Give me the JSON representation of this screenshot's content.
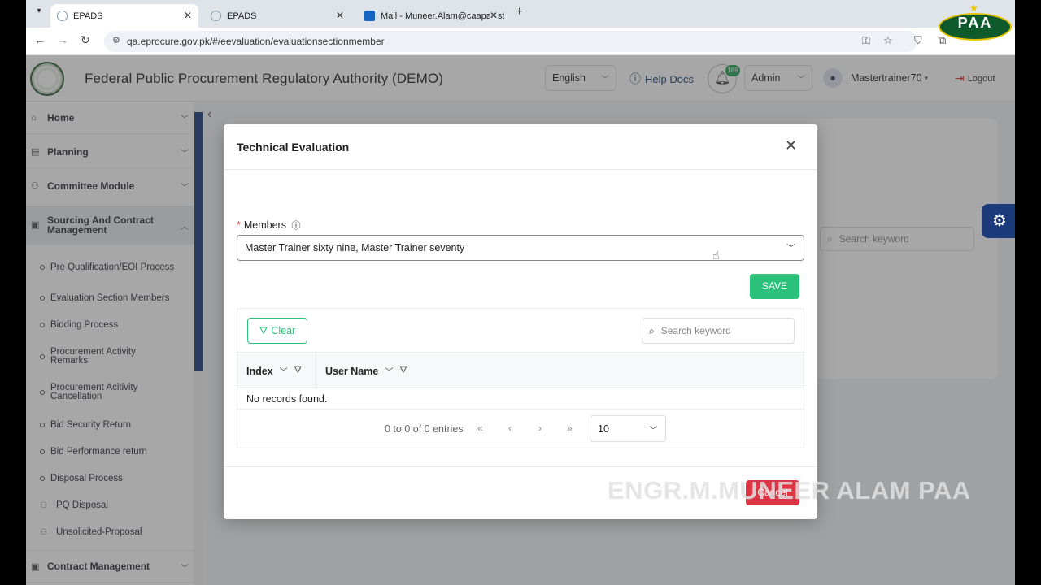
{
  "browser": {
    "tabs": [
      {
        "title": "EPADS",
        "active": true
      },
      {
        "title": "EPADS",
        "active": false
      },
      {
        "title": "Mail - Muneer.Alam@caapakist",
        "active": false
      }
    ],
    "url": "qa.eprocure.gov.pk/#/eevaluation/evaluationsectionmember"
  },
  "header": {
    "title": "Federal Public Procurement Regulatory Authority (DEMO)",
    "language": "English",
    "help": "Help Docs",
    "notif_count": "189",
    "role": "Admin",
    "user": "Mastertrainer70",
    "logout": "Logout"
  },
  "sidebar": {
    "main": [
      {
        "label": "Home"
      },
      {
        "label": "Planning"
      },
      {
        "label": "Committee Module"
      },
      {
        "label": "Sourcing And Contract Management"
      },
      {
        "label": "Contract Management"
      }
    ],
    "sub": [
      {
        "label": "Pre Qualification/EOI Process"
      },
      {
        "label": "Evaluation Section Members"
      },
      {
        "label": "Bidding Process"
      },
      {
        "label": "Procurement Activity Remarks"
      },
      {
        "label": "Procurement Acitivity Cancellation"
      },
      {
        "label": "Bid Security Return"
      },
      {
        "label": "Bid Performance return"
      },
      {
        "label": "Disposal Process"
      },
      {
        "label": "PQ Disposal"
      },
      {
        "label": "Unsolicited-Proposal"
      }
    ]
  },
  "background": {
    "search_placeholder": "Search keyword"
  },
  "modal": {
    "title": "Technical Evaluation",
    "members_label": "Members",
    "members_value": "Master Trainer sixty nine, Master Trainer seventy",
    "save": "SAVE",
    "clear": "Clear",
    "search_placeholder": "Search keyword",
    "columns": [
      "Index",
      "User Name"
    ],
    "empty": "No records found.",
    "pager_info": "0 to 0 of 0 entries",
    "page_size": "10",
    "cancel": "Cancel"
  },
  "watermark": "ENGR.M.MUNEER ALAM PAA",
  "logo_text": "PAA",
  "colors": {
    "primary": "#1b3b7a",
    "success": "#2cc17b",
    "danger": "#dc3545"
  }
}
